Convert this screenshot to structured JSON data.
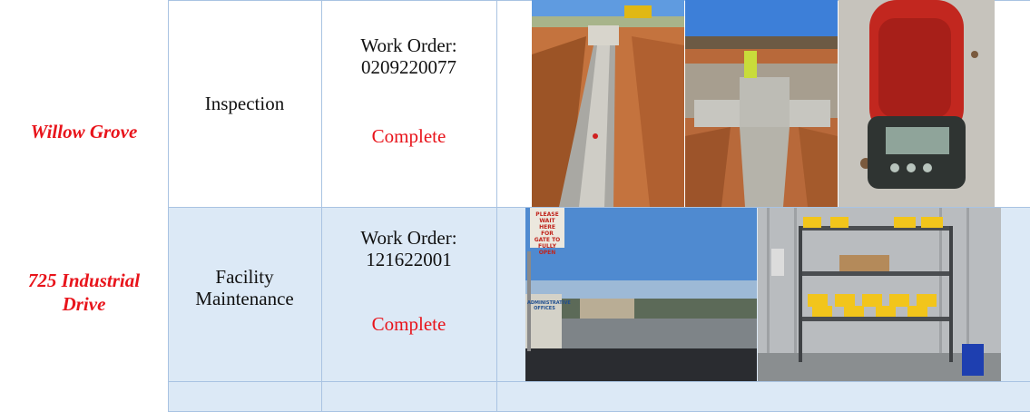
{
  "rows": [
    {
      "location": "Willow Grove",
      "type": "Inspection",
      "work_order_label": "Work Order:",
      "work_order_number": "0209220077",
      "status": "Complete"
    },
    {
      "location_line1": "725 Industrial",
      "location_line2": "Drive",
      "type_line1": "Facility",
      "type_line2": "Maintenance",
      "work_order_label": "Work Order:",
      "work_order_number": "121622001",
      "status": "Complete"
    }
  ],
  "photos": {
    "sign_text": [
      "PLEASE",
      "WAIT HERE",
      "FOR GATE TO",
      "FULLY OPEN"
    ],
    "building_sign_text": "ADMINISTRATIVE OFFICES"
  },
  "colors": {
    "accent_red": "#e8141b",
    "row_shade": "#dce9f6",
    "grid_line": "#a9c3e2"
  }
}
